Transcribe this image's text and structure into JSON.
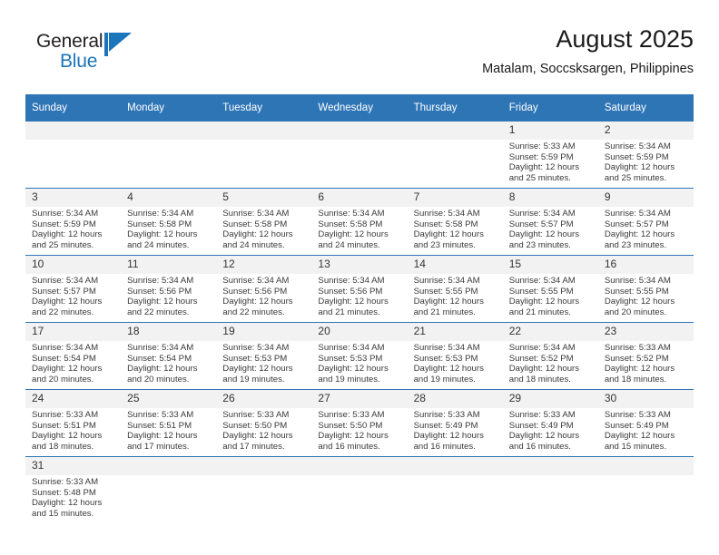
{
  "brand": {
    "name_part1": "General",
    "name_part2": "Blue",
    "mark_icon": "triangle-flag-icon",
    "accent_color": "#1b75bb"
  },
  "header": {
    "title": "August 2025",
    "subtitle": "Matalam, Soccsksargen, Philippines"
  },
  "theme": {
    "header_row_bg": "#2e75b6",
    "day_number_bg": "#f2f2f2",
    "row_divider": "#2e75b6",
    "text": "#1a1a1a"
  },
  "weekdays": [
    "Sunday",
    "Monday",
    "Tuesday",
    "Wednesday",
    "Thursday",
    "Friday",
    "Saturday"
  ],
  "labels": {
    "sunrise_prefix": "Sunrise:",
    "sunset_prefix": "Sunset:",
    "daylight_prefix": "Daylight:"
  },
  "weeks": [
    [
      {
        "empty": true
      },
      {
        "empty": true
      },
      {
        "empty": true
      },
      {
        "empty": true
      },
      {
        "empty": true
      },
      {
        "day": "1",
        "sunrise": "Sunrise: 5:33 AM",
        "sunset": "Sunset: 5:59 PM",
        "daylight": "Daylight: 12 hours and 25 minutes."
      },
      {
        "day": "2",
        "sunrise": "Sunrise: 5:34 AM",
        "sunset": "Sunset: 5:59 PM",
        "daylight": "Daylight: 12 hours and 25 minutes."
      }
    ],
    [
      {
        "day": "3",
        "sunrise": "Sunrise: 5:34 AM",
        "sunset": "Sunset: 5:59 PM",
        "daylight": "Daylight: 12 hours and 25 minutes."
      },
      {
        "day": "4",
        "sunrise": "Sunrise: 5:34 AM",
        "sunset": "Sunset: 5:58 PM",
        "daylight": "Daylight: 12 hours and 24 minutes."
      },
      {
        "day": "5",
        "sunrise": "Sunrise: 5:34 AM",
        "sunset": "Sunset: 5:58 PM",
        "daylight": "Daylight: 12 hours and 24 minutes."
      },
      {
        "day": "6",
        "sunrise": "Sunrise: 5:34 AM",
        "sunset": "Sunset: 5:58 PM",
        "daylight": "Daylight: 12 hours and 24 minutes."
      },
      {
        "day": "7",
        "sunrise": "Sunrise: 5:34 AM",
        "sunset": "Sunset: 5:58 PM",
        "daylight": "Daylight: 12 hours and 23 minutes."
      },
      {
        "day": "8",
        "sunrise": "Sunrise: 5:34 AM",
        "sunset": "Sunset: 5:57 PM",
        "daylight": "Daylight: 12 hours and 23 minutes."
      },
      {
        "day": "9",
        "sunrise": "Sunrise: 5:34 AM",
        "sunset": "Sunset: 5:57 PM",
        "daylight": "Daylight: 12 hours and 23 minutes."
      }
    ],
    [
      {
        "day": "10",
        "sunrise": "Sunrise: 5:34 AM",
        "sunset": "Sunset: 5:57 PM",
        "daylight": "Daylight: 12 hours and 22 minutes."
      },
      {
        "day": "11",
        "sunrise": "Sunrise: 5:34 AM",
        "sunset": "Sunset: 5:56 PM",
        "daylight": "Daylight: 12 hours and 22 minutes."
      },
      {
        "day": "12",
        "sunrise": "Sunrise: 5:34 AM",
        "sunset": "Sunset: 5:56 PM",
        "daylight": "Daylight: 12 hours and 22 minutes."
      },
      {
        "day": "13",
        "sunrise": "Sunrise: 5:34 AM",
        "sunset": "Sunset: 5:56 PM",
        "daylight": "Daylight: 12 hours and 21 minutes."
      },
      {
        "day": "14",
        "sunrise": "Sunrise: 5:34 AM",
        "sunset": "Sunset: 5:55 PM",
        "daylight": "Daylight: 12 hours and 21 minutes."
      },
      {
        "day": "15",
        "sunrise": "Sunrise: 5:34 AM",
        "sunset": "Sunset: 5:55 PM",
        "daylight": "Daylight: 12 hours and 21 minutes."
      },
      {
        "day": "16",
        "sunrise": "Sunrise: 5:34 AM",
        "sunset": "Sunset: 5:55 PM",
        "daylight": "Daylight: 12 hours and 20 minutes."
      }
    ],
    [
      {
        "day": "17",
        "sunrise": "Sunrise: 5:34 AM",
        "sunset": "Sunset: 5:54 PM",
        "daylight": "Daylight: 12 hours and 20 minutes."
      },
      {
        "day": "18",
        "sunrise": "Sunrise: 5:34 AM",
        "sunset": "Sunset: 5:54 PM",
        "daylight": "Daylight: 12 hours and 20 minutes."
      },
      {
        "day": "19",
        "sunrise": "Sunrise: 5:34 AM",
        "sunset": "Sunset: 5:53 PM",
        "daylight": "Daylight: 12 hours and 19 minutes."
      },
      {
        "day": "20",
        "sunrise": "Sunrise: 5:34 AM",
        "sunset": "Sunset: 5:53 PM",
        "daylight": "Daylight: 12 hours and 19 minutes."
      },
      {
        "day": "21",
        "sunrise": "Sunrise: 5:34 AM",
        "sunset": "Sunset: 5:53 PM",
        "daylight": "Daylight: 12 hours and 19 minutes."
      },
      {
        "day": "22",
        "sunrise": "Sunrise: 5:34 AM",
        "sunset": "Sunset: 5:52 PM",
        "daylight": "Daylight: 12 hours and 18 minutes."
      },
      {
        "day": "23",
        "sunrise": "Sunrise: 5:33 AM",
        "sunset": "Sunset: 5:52 PM",
        "daylight": "Daylight: 12 hours and 18 minutes."
      }
    ],
    [
      {
        "day": "24",
        "sunrise": "Sunrise: 5:33 AM",
        "sunset": "Sunset: 5:51 PM",
        "daylight": "Daylight: 12 hours and 18 minutes."
      },
      {
        "day": "25",
        "sunrise": "Sunrise: 5:33 AM",
        "sunset": "Sunset: 5:51 PM",
        "daylight": "Daylight: 12 hours and 17 minutes."
      },
      {
        "day": "26",
        "sunrise": "Sunrise: 5:33 AM",
        "sunset": "Sunset: 5:50 PM",
        "daylight": "Daylight: 12 hours and 17 minutes."
      },
      {
        "day": "27",
        "sunrise": "Sunrise: 5:33 AM",
        "sunset": "Sunset: 5:50 PM",
        "daylight": "Daylight: 12 hours and 16 minutes."
      },
      {
        "day": "28",
        "sunrise": "Sunrise: 5:33 AM",
        "sunset": "Sunset: 5:49 PM",
        "daylight": "Daylight: 12 hours and 16 minutes."
      },
      {
        "day": "29",
        "sunrise": "Sunrise: 5:33 AM",
        "sunset": "Sunset: 5:49 PM",
        "daylight": "Daylight: 12 hours and 16 minutes."
      },
      {
        "day": "30",
        "sunrise": "Sunrise: 5:33 AM",
        "sunset": "Sunset: 5:49 PM",
        "daylight": "Daylight: 12 hours and 15 minutes."
      }
    ],
    [
      {
        "day": "31",
        "sunrise": "Sunrise: 5:33 AM",
        "sunset": "Sunset: 5:48 PM",
        "daylight": "Daylight: 12 hours and 15 minutes."
      },
      {
        "empty": true
      },
      {
        "empty": true
      },
      {
        "empty": true
      },
      {
        "empty": true
      },
      {
        "empty": true
      },
      {
        "empty": true
      }
    ]
  ]
}
